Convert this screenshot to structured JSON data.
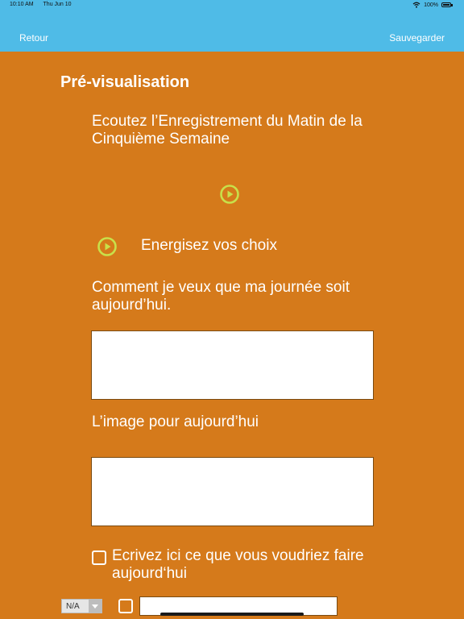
{
  "status_bar": {
    "time": "10:10 AM",
    "date": "Thu Jun 10",
    "battery": "100%"
  },
  "nav": {
    "back_label": "Retour",
    "save_label": "Sauvegarder"
  },
  "page": {
    "title": "Pré-visualisation"
  },
  "content": {
    "heading": "Ecoutez l’Enregistrement du Matin de la Cinquième Semaine",
    "audio_label": "Energisez vos choix",
    "q1_label": "Comment je veux que ma journée soit aujourd’hui.",
    "q1_value": "",
    "q2_label": "L’image pour aujourd’hui",
    "q2_value": "",
    "checklist_label": "Ecrivez ici ce que vous voudriez faire aujourd‘hui",
    "item_select_value": "N/A",
    "item_text_value": ""
  },
  "colors": {
    "background": "#d57a1b",
    "nav": "#4fbbe7",
    "play_icon": "#c8e04a"
  }
}
